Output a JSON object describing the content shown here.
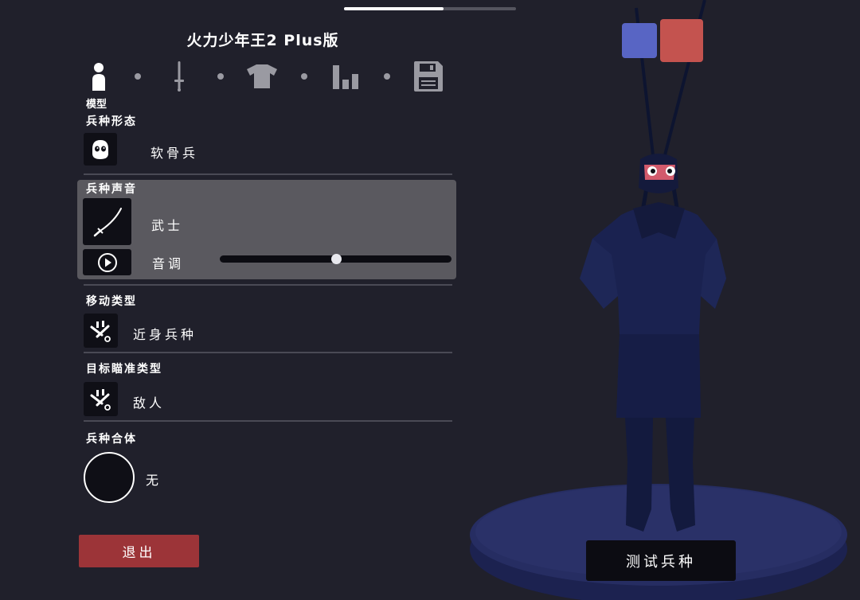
{
  "app": {
    "title": "火力少年王2 Plus版",
    "progress_fraction": 0.58
  },
  "tabs": [
    {
      "name": "model",
      "icon": "person-icon",
      "caption": "模型",
      "active": true
    },
    {
      "name": "weapon",
      "icon": "sword-icon",
      "active": false
    },
    {
      "name": "clothing",
      "icon": "shirt-icon",
      "active": false
    },
    {
      "name": "stats",
      "icon": "bar-chart-icon",
      "active": false
    },
    {
      "name": "save",
      "icon": "floppy-disk-icon",
      "active": false
    }
  ],
  "form": {
    "label": "兵种形态",
    "value": "软骨兵",
    "icon": "ghost-face-icon"
  },
  "sound": {
    "label": "兵种声音",
    "value": "武士",
    "icon": "katana-icon",
    "play_icon": "play-icon",
    "pitch_label": "音调",
    "pitch_fraction": 0.5
  },
  "movement": {
    "label": "移动类型",
    "value": "近身兵种",
    "icon": "melee-icon"
  },
  "targeting": {
    "label": "目标瞄准类型",
    "value": "敌人",
    "icon": "melee-icon"
  },
  "fusion": {
    "label": "兵种合体",
    "value": "无"
  },
  "buttons": {
    "exit": "退出",
    "test_unit": "测试兵种"
  },
  "colors": {
    "team_blue": "#5865c4",
    "team_red": "#c4534f",
    "exit_button": "#9c3438",
    "background": "#20202b"
  }
}
